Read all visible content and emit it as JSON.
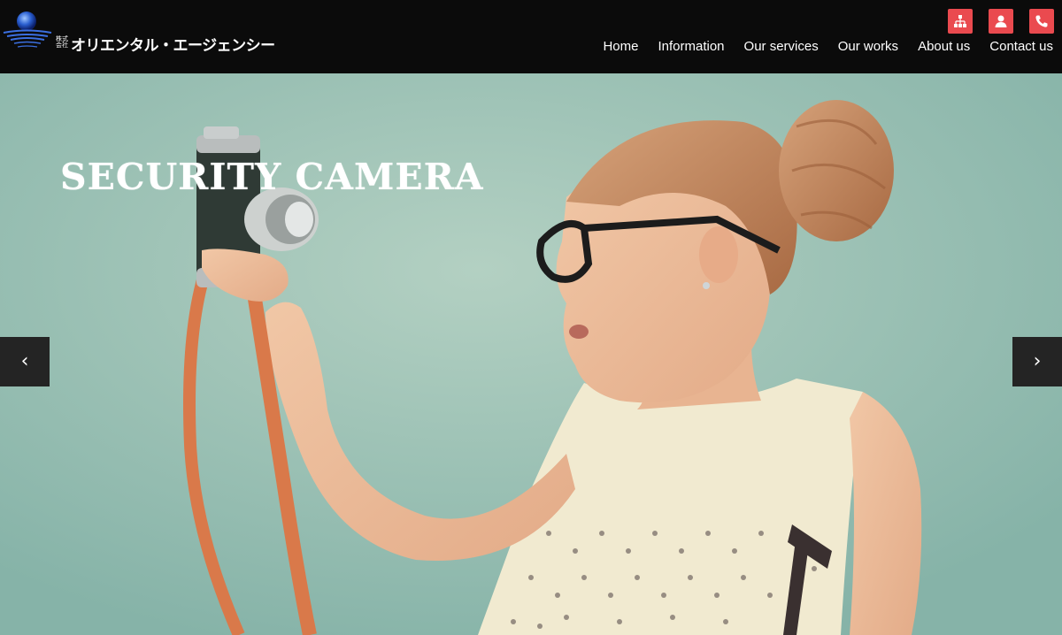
{
  "header": {
    "logo": {
      "small_text": "株式会社",
      "name": "オリエンタル・エージェンシー"
    },
    "utility_icons": [
      "sitemap-icon",
      "user-icon",
      "phone-icon"
    ],
    "nav": [
      {
        "label": "Home"
      },
      {
        "label": "Information"
      },
      {
        "label": "Our services"
      },
      {
        "label": "Our works"
      },
      {
        "label": "About us"
      },
      {
        "label": "Contact us"
      }
    ]
  },
  "hero": {
    "title": "SECURITY CAMERA",
    "prev_arrow": "‹",
    "next_arrow": "›"
  },
  "colors": {
    "header_bg": "#0b0b0b",
    "accent": "#ea4a4f",
    "hero_bg": "#9cc3b5",
    "arrow_bg": "#242424"
  }
}
